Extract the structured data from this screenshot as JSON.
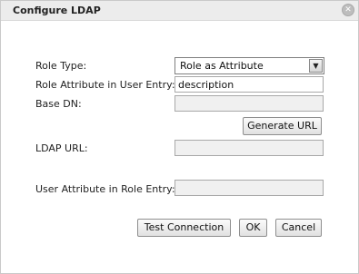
{
  "dialog": {
    "title": "Configure LDAP",
    "close_icon": "close-icon"
  },
  "form": {
    "role_type": {
      "label": "Role Type:",
      "value": "Role as Attribute"
    },
    "role_attribute": {
      "label": "Role Attribute in User Entry:",
      "value": "description"
    },
    "base_dn": {
      "label": "Base DN:",
      "value": ""
    },
    "generate_url_label": "Generate URL",
    "ldap_url": {
      "label": "LDAP URL:",
      "value": ""
    },
    "user_attribute": {
      "label": "User Attribute in Role Entry:",
      "value": ""
    }
  },
  "buttons": {
    "test_connection": "Test Connection",
    "ok": "OK",
    "cancel": "Cancel"
  }
}
